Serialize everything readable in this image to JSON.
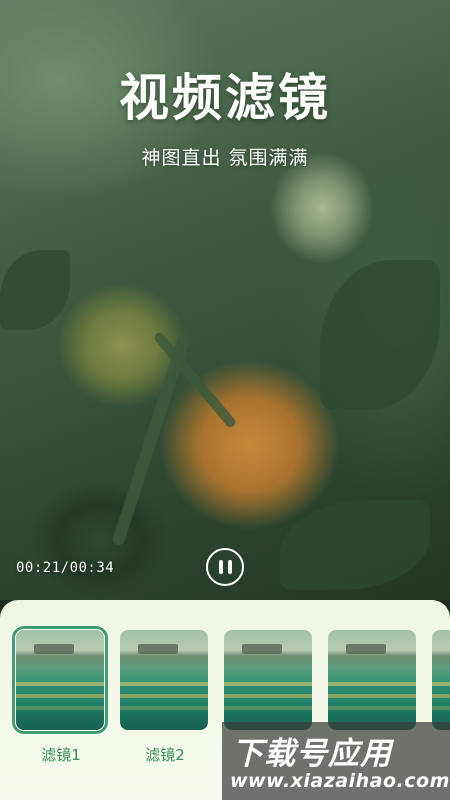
{
  "header": {
    "title": "视频滤镜",
    "subtitle": "神图直出  氛围满满"
  },
  "player": {
    "time_readout": "00:21/00:34",
    "state_icon": "pause-icon"
  },
  "filters": {
    "items": [
      {
        "label": "滤镜1",
        "selected": true
      },
      {
        "label": "滤镜2",
        "selected": false
      },
      {
        "label": "",
        "selected": false
      },
      {
        "label": "",
        "selected": false
      },
      {
        "label": "",
        "selected": false
      }
    ]
  },
  "watermark": {
    "brand": "下载号应用",
    "url": "www.xiazaihao.com"
  },
  "colors": {
    "accent": "#3e9c6d",
    "label": "#3b8f56",
    "panel_bg": "#eef7e1"
  }
}
